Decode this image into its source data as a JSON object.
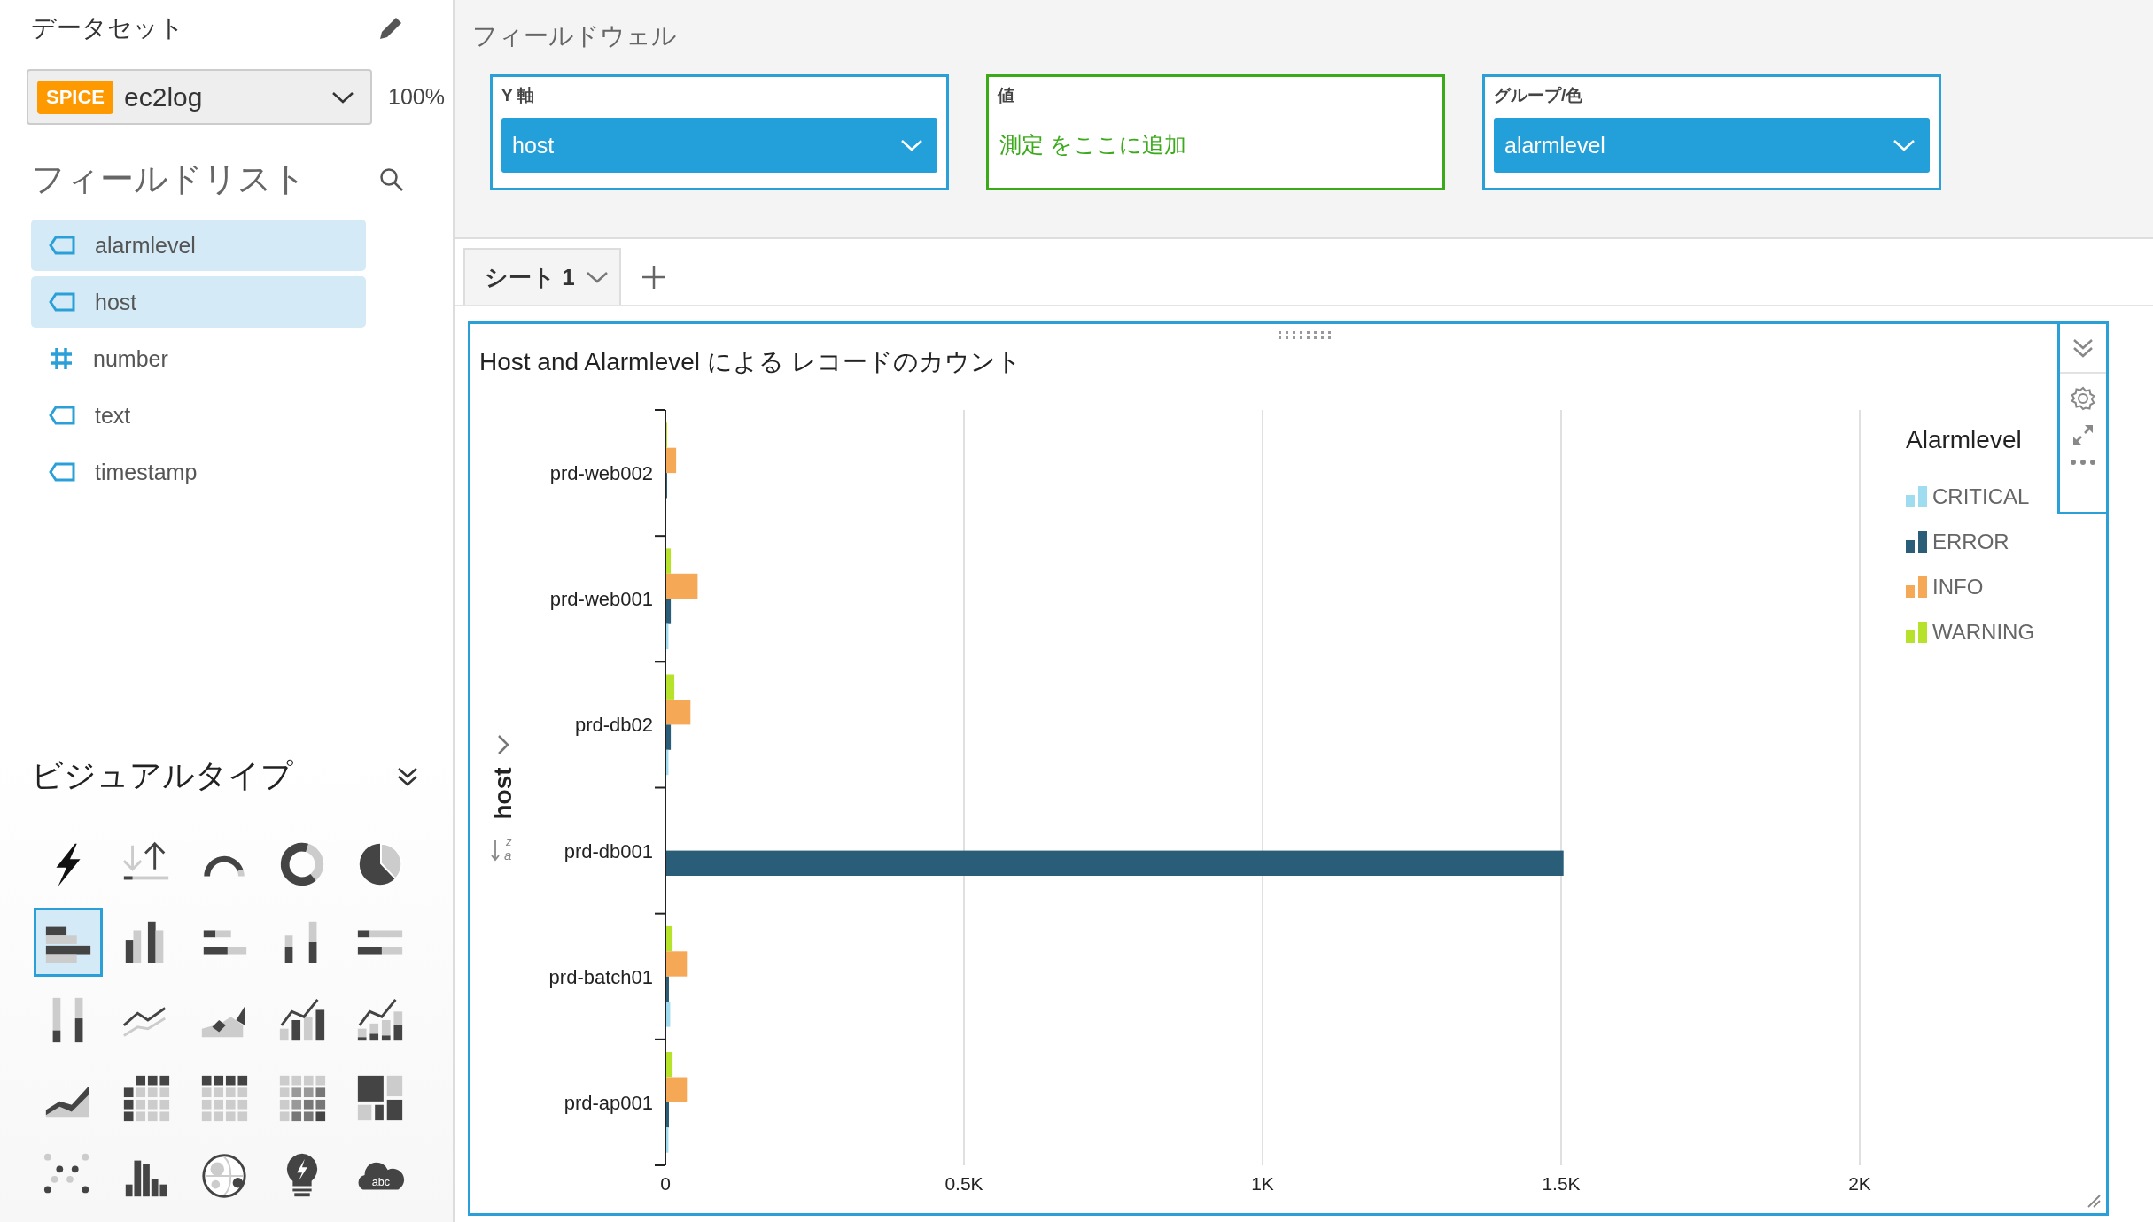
{
  "dataset": {
    "title": "データセット",
    "badge": "SPICE",
    "name": "ec2log",
    "percent": "100%"
  },
  "field_list": {
    "title": "フィールドリスト",
    "items": [
      {
        "name": "alarmlevel",
        "kind": "dimension",
        "selected": true
      },
      {
        "name": "host",
        "kind": "dimension",
        "selected": true
      },
      {
        "name": "number",
        "kind": "measure",
        "selected": false
      },
      {
        "name": "text",
        "kind": "dimension",
        "selected": false
      },
      {
        "name": "timestamp",
        "kind": "dimension",
        "selected": false
      }
    ]
  },
  "visual_types": {
    "title": "ビジュアルタイプ",
    "items": [
      {
        "kind": "kpi",
        "selected": false
      },
      {
        "kind": "arrows",
        "selected": false
      },
      {
        "kind": "gauge",
        "selected": false
      },
      {
        "kind": "donut",
        "selected": false
      },
      {
        "kind": "pie",
        "selected": false
      },
      {
        "kind": "hbar",
        "selected": true
      },
      {
        "kind": "vbar",
        "selected": false
      },
      {
        "kind": "hstack",
        "selected": false
      },
      {
        "kind": "vstack",
        "selected": false
      },
      {
        "kind": "hfull",
        "selected": false
      },
      {
        "kind": "vfull",
        "selected": false
      },
      {
        "kind": "line",
        "selected": false
      },
      {
        "kind": "area",
        "selected": false
      },
      {
        "kind": "combo",
        "selected": false
      },
      {
        "kind": "combostack",
        "selected": false
      },
      {
        "kind": "areaview",
        "selected": false
      },
      {
        "kind": "pivot",
        "selected": false
      },
      {
        "kind": "table",
        "selected": false
      },
      {
        "kind": "heatmap",
        "selected": false
      },
      {
        "kind": "treemap",
        "selected": false
      },
      {
        "kind": "scatter",
        "selected": false
      },
      {
        "kind": "histogram",
        "selected": false
      },
      {
        "kind": "map",
        "selected": false
      },
      {
        "kind": "insight",
        "selected": false
      },
      {
        "kind": "wordcloud",
        "selected": false,
        "label": "abc"
      }
    ]
  },
  "field_wells": {
    "title": "フィールドウェル",
    "wells": [
      {
        "label": "Y 軸",
        "kind": "field",
        "value": "host"
      },
      {
        "label": "値",
        "kind": "empty",
        "placeholder": "測定 をここに追加"
      },
      {
        "label": "グループ/色",
        "kind": "field",
        "value": "alarmlevel"
      }
    ]
  },
  "sheets": {
    "tabs": [
      {
        "label": "シート 1",
        "selected": true
      }
    ]
  },
  "chart": {
    "legend_title": "Alarmlevel",
    "sort_letters": [
      "z",
      "a"
    ],
    "chart_data": {
      "type": "bar",
      "orientation": "horizontal",
      "title": "Host and Alarmlevel による レコードのカウント",
      "ylabel": "host",
      "categories": [
        "prd-web002",
        "prd-web001",
        "prd-db02",
        "prd-db001",
        "prd-batch01",
        "prd-ap001"
      ],
      "series": [
        {
          "name": "CRITICAL",
          "color": "#9fdcf0",
          "values": [
            null,
            5,
            5,
            null,
            8,
            5
          ]
        },
        {
          "name": "ERROR",
          "color": "#2a5d78",
          "values": [
            3,
            9,
            9,
            1504,
            6,
            6
          ]
        },
        {
          "name": "INFO",
          "color": "#f5a956",
          "values": [
            18,
            54,
            42,
            null,
            36,
            36
          ]
        },
        {
          "name": "WARNING",
          "color": "#b7e22b",
          "values": [
            3,
            9,
            15,
            null,
            12,
            12
          ]
        }
      ],
      "xlim": [
        0,
        2000
      ],
      "grid": true,
      "xticks": [
        0,
        {
          "value": 500,
          "label": "0.5K"
        },
        {
          "value": 1000,
          "label": "1K"
        },
        {
          "value": 1500,
          "label": "1.5K"
        },
        {
          "value": 2000,
          "label": "2K"
        }
      ]
    }
  }
}
